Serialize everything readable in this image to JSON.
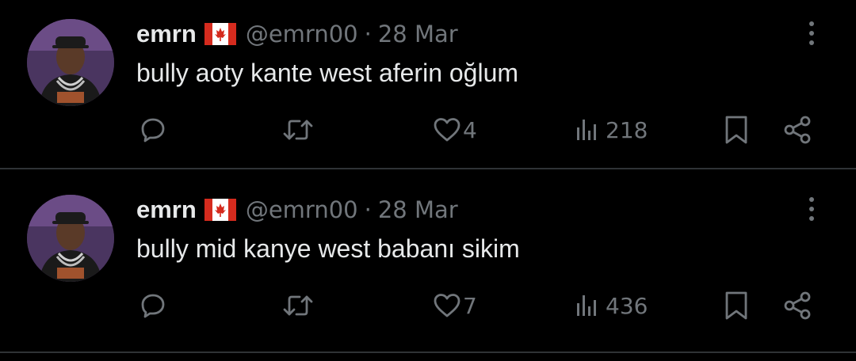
{
  "tweets": [
    {
      "author_name": "emrn",
      "flag": "canada-flag-icon",
      "handle": "@emrn00",
      "separator": "·",
      "date": "28 Mar",
      "text": "bully aoty kante west aferin oğlum",
      "likes": "4",
      "views": "218"
    },
    {
      "author_name": "emrn",
      "flag": "canada-flag-icon",
      "handle": "@emrn00",
      "separator": "·",
      "date": "28 Mar",
      "text": "bully mid kanye west babanı sikim",
      "likes": "7",
      "views": "436"
    }
  ],
  "colors": {
    "background": "#000000",
    "primary_text": "#e7e9ea",
    "secondary_text": "#71767b",
    "divider": "#2f3336",
    "flag_red": "#d52b1e"
  },
  "icons": [
    "reply-icon",
    "retweet-icon",
    "like-icon",
    "views-icon",
    "bookmark-icon",
    "share-icon",
    "more-icon"
  ]
}
